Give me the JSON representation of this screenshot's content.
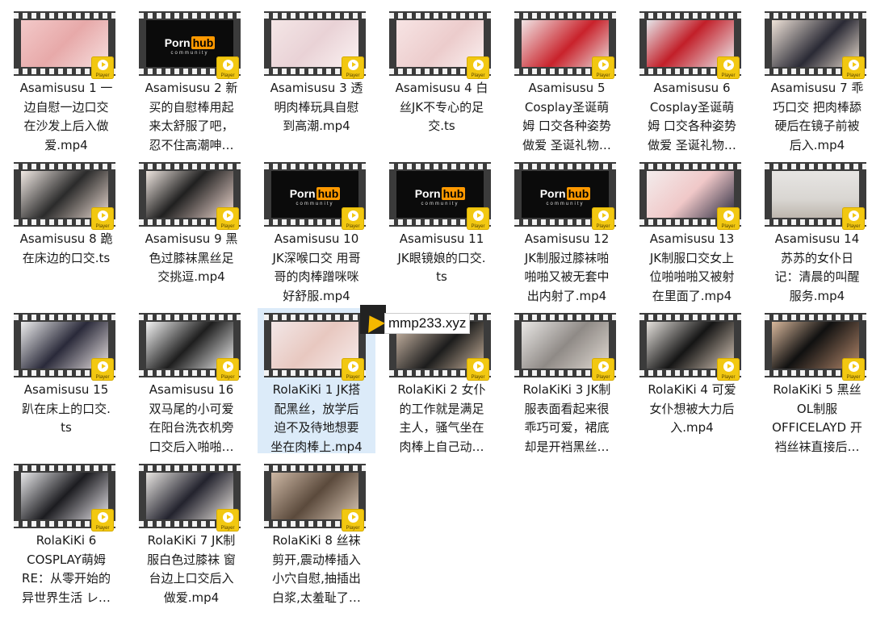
{
  "badge_text": "Player",
  "ph_logo": {
    "porn": "Porn",
    "hub": "hub",
    "sub": "community"
  },
  "watermark": "mmp233.xyz",
  "colors": {
    "selected": "#dcebf9",
    "badge": "#f2c811",
    "film": "#3b3b3b"
  },
  "items": [
    {
      "name": "Asamisusu 1 一边自慰一边口交在沙发上后入做爱.mp4",
      "lines": [
        "Asamisusu 1 一",
        "边自慰一边口交",
        "在沙发上后入做",
        "爱.mp4"
      ],
      "thumb": "photo",
      "bg": "linear-gradient(135deg,#f3c9c9,#e7a9a9 50%,#f6dede)"
    },
    {
      "name": "Asamisusu 2 新买的自慰棒用起来太舒服了吧，忍不住高潮呻…",
      "lines": [
        "Asamisusu 2 新",
        "买的自慰棒用起",
        "来太舒服了吧，",
        "忍不住高潮呻…"
      ],
      "thumb": "logo",
      "bg": ""
    },
    {
      "name": "Asamisusu 3 透明肉棒玩具自慰到高潮.mp4",
      "lines": [
        "Asamisusu 3 透",
        "明肉棒玩具自慰",
        "到高潮.mp4"
      ],
      "thumb": "photo",
      "bg": "linear-gradient(135deg,#f4e6e6,#e9d2d6 50%,#fbf2f2)"
    },
    {
      "name": "Asamisusu 4 白丝JK不专心的足交.ts",
      "lines": [
        "Asamisusu 4 白",
        "丝JK不专心的足",
        "交.ts"
      ],
      "thumb": "photo",
      "bg": "linear-gradient(135deg,#f7e4e4,#eccccc 55%,#faf0f0)"
    },
    {
      "name": "Asamisusu 5 Cosplay圣诞萌姆 口交各种姿势做爱 圣诞礼物…",
      "lines": [
        "Asamisusu 5",
        "Cosplay圣诞萌",
        "姆 口交各种姿势",
        "做爱 圣诞礼物…"
      ],
      "thumb": "photo",
      "bg": "linear-gradient(135deg,#f0e4e4,#c9222b 55%,#e9dada)"
    },
    {
      "name": "Asamisusu 6 Cosplay圣诞萌姆 口交各种姿势做爱 圣诞礼物…",
      "lines": [
        "Asamisusu 6",
        "Cosplay圣诞萌",
        "姆 口交各种姿势",
        "做爱 圣诞礼物…"
      ],
      "thumb": "photo",
      "bg": "linear-gradient(135deg,#e6e6ea,#c21f29 45%,#ececef)"
    },
    {
      "name": "Asamisusu 7 乖巧口交 把肉棒舔硬后在镜子前被后入.mp4",
      "lines": [
        "Asamisusu 7 乖",
        "巧口交 把肉棒舔",
        "硬后在镜子前被",
        "后入.mp4"
      ],
      "thumb": "photo",
      "bg": "linear-gradient(135deg,#efe3d8,#2a2a35 55%,#e9dccf)"
    },
    {
      "name": "Asamisusu 8 跪在床边的口交.ts",
      "lines": [
        "Asamisusu 8 跪",
        "在床边的口交.ts"
      ],
      "thumb": "photo",
      "bg": "linear-gradient(135deg,#f1e9e4,#2b2b2b 50%,#e8d8cf)"
    },
    {
      "name": "Asamisusu 9 黑色过膝袜黑丝足交挑逗.mp4",
      "lines": [
        "Asamisusu 9 黑",
        "色过膝袜黑丝足",
        "交挑逗.mp4"
      ],
      "thumb": "photo",
      "bg": "linear-gradient(135deg,#efe6e0,#202020 45%,#f0d8d0)"
    },
    {
      "name": "Asamisusu 10 JK深喉口交 用哥哥的肉棒蹭咪咪好舒服.mp4",
      "lines": [
        "Asamisusu 10",
        "JK深喉口交 用哥",
        "哥的肉棒蹭咪咪",
        "好舒服.mp4"
      ],
      "thumb": "logo",
      "bg": ""
    },
    {
      "name": "Asamisusu 11 JK眼镜娘的口交.ts",
      "lines": [
        "Asamisusu 11",
        "JK眼镜娘的口交.",
        "ts"
      ],
      "thumb": "logo",
      "bg": ""
    },
    {
      "name": "Asamisusu 12 JK制服过膝袜啪啪啪又被无套中出内射了.mp4",
      "lines": [
        "Asamisusu 12",
        "JK制服过膝袜啪",
        "啪啪又被无套中",
        "出内射了.mp4"
      ],
      "thumb": "logo",
      "bg": ""
    },
    {
      "name": "Asamisusu 13 JK制服口交女上位啪啪啪又被射在里面了.mp4",
      "lines": [
        "Asamisusu 13",
        "JK制服口交女上",
        "位啪啪啪又被射",
        "在里面了.mp4"
      ],
      "thumb": "photo",
      "bg": "linear-gradient(135deg,#f3ecec,#f0c8c8 50%,#2b2b40)"
    },
    {
      "name": "Asamisusu 14 苏苏的女仆日记：清晨的叫醒服务.mp4",
      "lines": [
        "Asamisusu 14",
        "苏苏的女仆日",
        "记：清晨的叫醒",
        "服务.mp4"
      ],
      "thumb": "photo",
      "bg": "linear-gradient(180deg,#e7e5e3,#d9d6d2 60%,#bdb6ad)"
    },
    {
      "name": "Asamisusu 15 趴在床上的口交.ts",
      "lines": [
        "Asamisusu 15",
        "趴在床上的口交.",
        "ts"
      ],
      "thumb": "photo",
      "bg": "linear-gradient(135deg,#eeeeee,#2a2a3a 50%,#e9e2e2)"
    },
    {
      "name": "Asamisusu 16 双马尾的小可爱在阳台洗衣机旁口交后入啪啪…",
      "lines": [
        "Asamisusu 16",
        "双马尾的小可爱",
        "在阳台洗衣机旁",
        "口交后入啪啪…"
      ],
      "thumb": "photo",
      "bg": "linear-gradient(135deg,#f4f4f4,#1e1e1e 50%,#efefef)"
    },
    {
      "name": "RolaKiKi 1 JK搭配黑丝，放学后迫不及待地想要坐在肉棒上.mp4",
      "lines": [
        "RolaKiKi 1 JK搭",
        "配黑丝，放学后",
        "迫不及待地想要",
        "坐在肉棒上.mp4"
      ],
      "thumb": "photo",
      "bg": "linear-gradient(135deg,#f2e7e7,#e8c8c0 50%,#f6eaea)",
      "selected": true
    },
    {
      "name": "RolaKiKi 2 女仆的工作就是满足主人，骚气坐在肉棒上自己动…",
      "lines": [
        "RolaKiKi 2 女仆",
        "的工作就是满足",
        "主人，骚气坐在",
        "肉棒上自己动…"
      ],
      "thumb": "photo",
      "bg": "linear-gradient(135deg,#d8c3b0,#1c1c1c 55%,#c9b39c)"
    },
    {
      "name": "RolaKiKi 3 JK制服表面看起来很乖巧可爱，裙底却是开裆黑丝…",
      "lines": [
        "RolaKiKi 3 JK制",
        "服表面看起来很",
        "乖巧可爱，裙底",
        "却是开裆黑丝…"
      ],
      "thumb": "photo",
      "bg": "linear-gradient(135deg,#e9e7e5,#8f8a86 50%,#e0d9d2)"
    },
    {
      "name": "RolaKiKi 4 可爱女仆想被大力后入.mp4",
      "lines": [
        "RolaKiKi 4 可爱",
        "女仆想被大力后",
        "入.mp4"
      ],
      "thumb": "photo",
      "bg": "linear-gradient(135deg,#e6e2dd,#151515 50%,#d9c9b9)"
    },
    {
      "name": "RolaKiKi 5 黑丝OL制服 OFFICELAYD 开裆丝袜直接后…",
      "lines": [
        "RolaKiKi 5 黑丝",
        "OL制服",
        "OFFICELAYD 开",
        "裆丝袜直接后…"
      ],
      "thumb": "photo",
      "bg": "linear-gradient(135deg,#d9b89c,#101010 45%,#b3876a)"
    },
    {
      "name": "RolaKiKi 6 COSPLAY萌姆 RE：从零开始的异世界生活 レ…",
      "lines": [
        "RolaKiKi 6",
        "COSPLAY萌姆",
        "RE：从零开始的",
        "异世界生活 レ…"
      ],
      "thumb": "photo",
      "bg": "linear-gradient(135deg,#e8e8ea,#1c1c20 50%,#e6e3e8)"
    },
    {
      "name": "RolaKiKi 7 JK制服白色过膝袜 窗台边上口交后入做爱.mp4",
      "lines": [
        "RolaKiKi 7 JK制",
        "服白色过膝袜 窗",
        "台边上口交后入",
        "做爱.mp4"
      ],
      "thumb": "photo",
      "bg": "linear-gradient(135deg,#e9e6e2,#23232e 50%,#ece6e0)"
    },
    {
      "name": "RolaKiKi 8 丝袜剪开,震动棒插入小穴自慰,抽插出白浆,太羞耻了…",
      "lines": [
        "RolaKiKi 8 丝袜",
        "剪开,震动棒插入",
        "小穴自慰,抽插出",
        "白浆,太羞耻了…"
      ],
      "thumb": "photo",
      "bg": "linear-gradient(135deg,#cdb8a5,#5b4a3c 50%,#d8c6b4)"
    }
  ]
}
